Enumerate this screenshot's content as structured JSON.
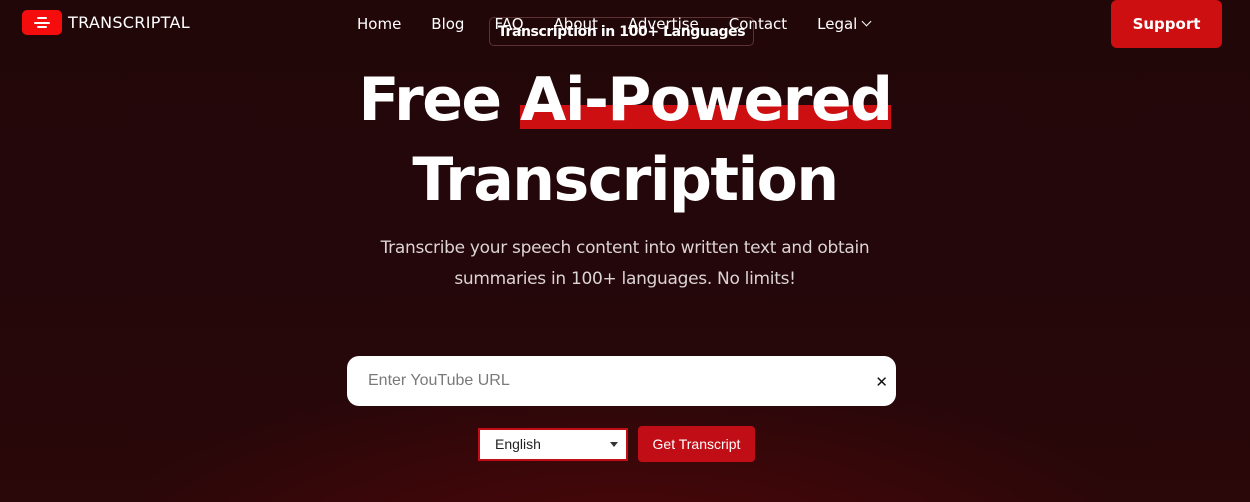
{
  "brand": {
    "name": "TRANSCRIPTAL",
    "logo_icon": "transcript-lines-icon",
    "accent_color": "#cd0f12"
  },
  "nav": {
    "items": [
      {
        "label": "Home"
      },
      {
        "label": "Blog"
      },
      {
        "label": "FAQ"
      },
      {
        "label": "About"
      },
      {
        "label": "Advertise"
      },
      {
        "label": "Contact"
      },
      {
        "label": "Legal",
        "icon": "chevron-down-icon"
      }
    ]
  },
  "badge": {
    "text": "Transcription in 100+ Languages"
  },
  "support_button": {
    "label": "Support"
  },
  "hero": {
    "title_prefix": "Free",
    "title_highlight": "Ai-Powered",
    "title_line2": "Transcription",
    "subtitle_line1": "Transcribe your speech content into written text and obtain",
    "subtitle_line2": "summaries in 100+ languages. No limits!"
  },
  "url_input": {
    "value": "",
    "placeholder": "Enter YouTube URL",
    "clear_icon": "close-icon",
    "clear_label": "✕"
  },
  "language_select": {
    "selected": "English"
  },
  "get_transcript_button": {
    "label": "Get Transcript"
  }
}
